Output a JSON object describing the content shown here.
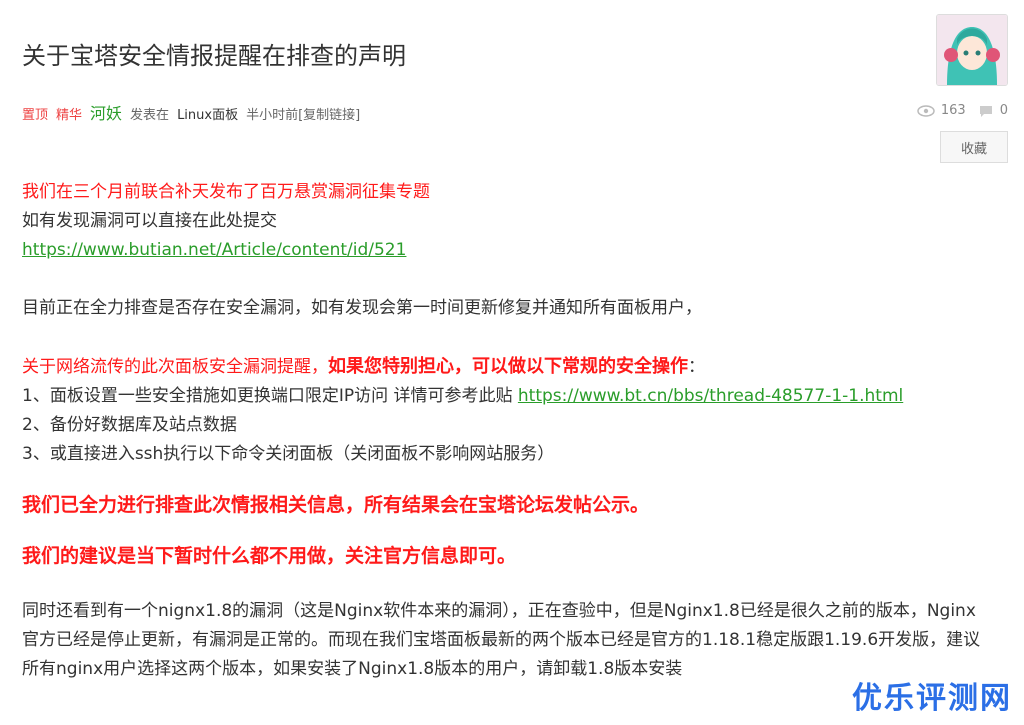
{
  "post": {
    "title": "关于宝塔安全情报提醒在排查的声明",
    "meta": {
      "tag_top": "置顶",
      "tag_digest": "精华",
      "author": "河妖",
      "posted_in": "发表在",
      "board": "Linux面板",
      "time": "半小时前",
      "copy_link": "[复制链接]"
    },
    "stats": {
      "views": "163",
      "comments": "0"
    },
    "collect_label": "收藏"
  },
  "content": {
    "p1_red": "我们在三个月前联合补天发布了百万悬赏漏洞征集专题",
    "p1_line2": "如有发现漏洞可以直接在此处提交",
    "p1_link": "https://www.butian.net/Article/content/id/521",
    "p2": "目前正在全力排查是否存在安全漏洞，如有发现会第一时间更新修复并通知所有面板用户，",
    "p3_red": "关于网络流传的此次面板安全漏洞提醒，",
    "p3_bold": "如果您特别担心，可以做以下常规的安全操作",
    "p3_colon": "：",
    "p3_item1": "1、面板设置一些安全措施如更换端口限定IP访问  详情可参考此贴 ",
    "p3_item1_link": "https://www.bt.cn/bbs/thread-48577-1-1.html",
    "p3_item2": "2、备份好数据库及站点数据",
    "p3_item3": "3、或直接进入ssh执行以下命令关闭面板（关闭面板不影响网站服务）",
    "p4_bold": "我们已全力进行排查此次情报相关信息，所有结果会在宝塔论坛发帖公示。",
    "p5_bold": "我们的建议是当下暂时什么都不用做，关注官方信息即可。",
    "p6": "同时还看到有一个nignx1.8的漏洞（这是Nginx软件本来的漏洞），正在查验中，但是Nginx1.8已经是很久之前的版本，Nginx官方已经是停止更新，有漏洞是正常的。而现在我们宝塔面板最新的两个版本已经是官方的1.18.1稳定版跟1.19.6开发版，建议所有nginx用户选择这两个版本，如果安装了Nginx1.8版本的用户，请卸载1.8版本安装"
  },
  "watermark": "优乐评测网"
}
